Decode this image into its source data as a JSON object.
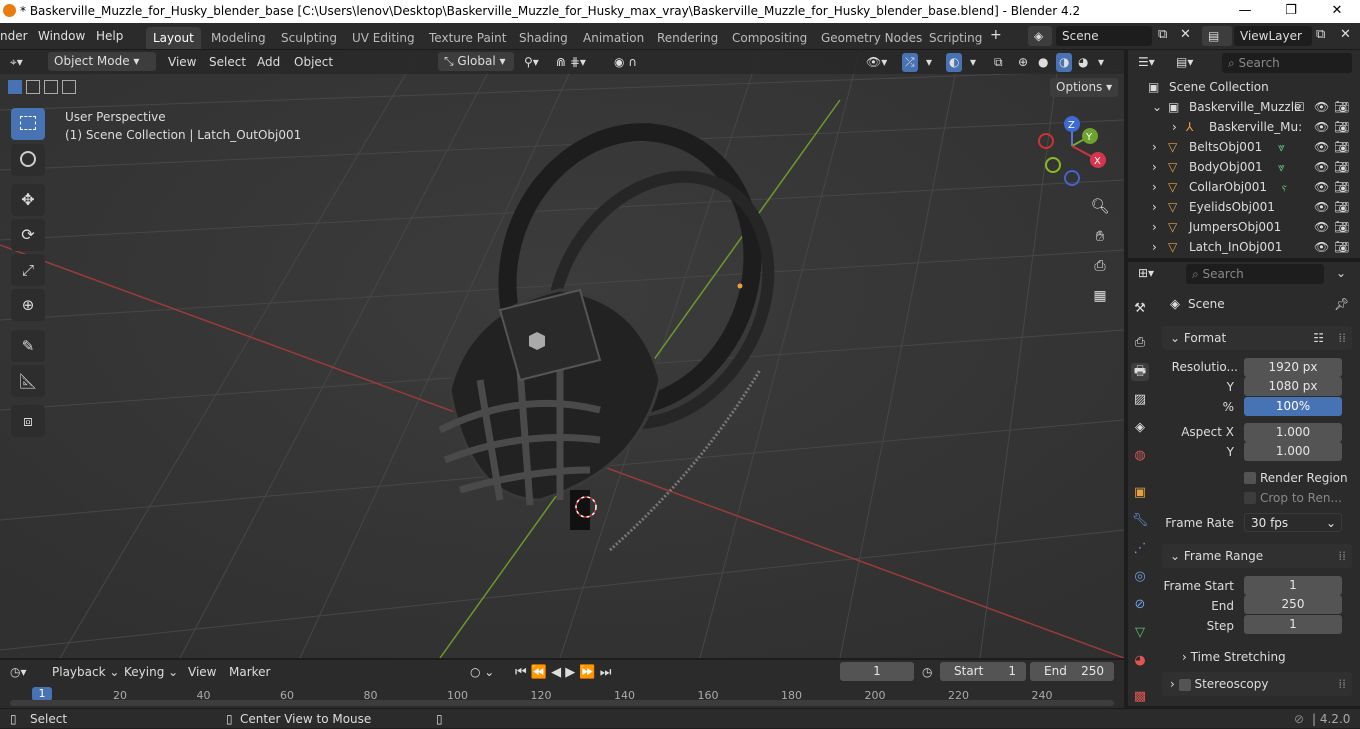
{
  "titlebar": {
    "title": "* Baskerville_Muzzle_for_Husky_blender_base [C:\\Users\\lenov\\Desktop\\Baskerville_Muzzle_for_Husky_max_vray\\Baskerville_Muzzle_for_Husky_blender_base.blend] - Blender 4.2",
    "minimize": "—",
    "maximize": "❐",
    "close": "✕"
  },
  "menubar": {
    "items": [
      "nder",
      "Window",
      "Help"
    ],
    "workspaces": [
      "Layout",
      "Modeling",
      "Sculpting",
      "UV Editing",
      "Texture Paint",
      "Shading",
      "Animation",
      "Rendering",
      "Compositing",
      "Geometry Nodes",
      "Scripting"
    ],
    "add_workspace": "+",
    "scene": "Scene",
    "view_layer": "ViewLayer"
  },
  "viewport_header": {
    "mode": "Object Mode",
    "menus": [
      "View",
      "Select",
      "Add",
      "Object"
    ],
    "orientation": "Global",
    "options": "Options"
  },
  "viewport": {
    "perspective": "User Perspective",
    "context": "(1) Scene Collection | Latch_OutObj001",
    "gizmo": {
      "z": "Z",
      "y": "Y",
      "x": "X"
    }
  },
  "outliner": {
    "search_placeholder": "Search",
    "root": "Scene Collection",
    "rows": [
      {
        "label": "Baskerville_Muzzle"
      },
      {
        "label": "Baskerville_Mu:"
      },
      {
        "label": "BeltsObj001"
      },
      {
        "label": "BodyObj001"
      },
      {
        "label": "CollarObj001"
      },
      {
        "label": "EyelidsObj001"
      },
      {
        "label": "JumpersObj001"
      },
      {
        "label": "Latch_InObj001"
      }
    ]
  },
  "properties": {
    "search_placeholder": "Search",
    "context": "Scene",
    "format": {
      "title": "Format",
      "res_label": "Resolutio...",
      "res_x": "1920 px",
      "y_label": "Y",
      "res_y": "1080 px",
      "pct_label": "%",
      "pct": "100%",
      "aspect_label": "Aspect X",
      "aspect_x": "1.000",
      "aspect_y_label": "Y",
      "aspect_y": "1.000",
      "render_region": "Render Region",
      "crop": "Crop to Ren...",
      "frame_rate_label": "Frame Rate",
      "frame_rate": "30 fps"
    },
    "frame_range": {
      "title": "Frame Range",
      "start_label": "Frame Start",
      "start": "1",
      "end_label": "End",
      "end": "250",
      "step_label": "Step",
      "step": "1"
    },
    "time_stretching": "Time Stretching",
    "stereoscopy": "Stereoscopy"
  },
  "timeline": {
    "menus": [
      "Playback",
      "Keying",
      "View",
      "Marker"
    ],
    "current_frame": "1",
    "start_label": "Start",
    "start": "1",
    "end_label": "End",
    "end": "250",
    "ticks": [
      "20",
      "40",
      "60",
      "80",
      "100",
      "120",
      "140",
      "160",
      "180",
      "200",
      "220",
      "240"
    ],
    "cursor": "1"
  },
  "statusbar": {
    "select": "Select",
    "center_view": "Center View to Mouse",
    "version": "4.2.0"
  }
}
